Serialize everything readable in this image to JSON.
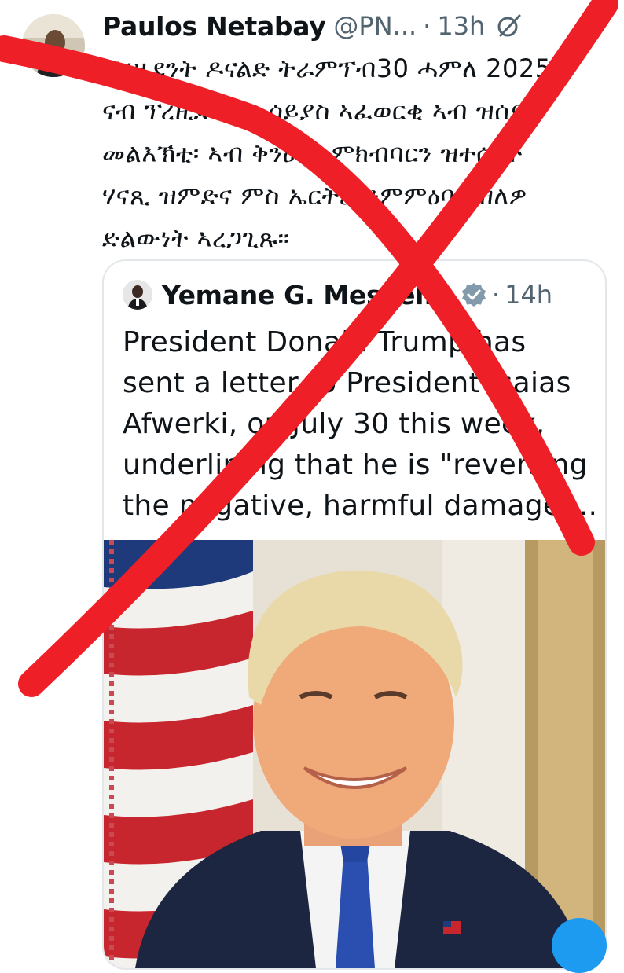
{
  "tweet": {
    "author_name": "Paulos Netabay",
    "author_handle": "@PN...",
    "separator": "·",
    "time": "13h",
    "grok_icon": "grok-icon",
    "text_lines": [
      "ፕረዚደንት ዶናልድ ትራምፕብ30 ሓምለ 2025",
      "ናብ ፕረዚደንት ኢሳይያስ ኣፈወርቂ ኣብ ዝሰደዶ",
      "መልእኽቲ፡ ኣብ ቅንዕናን ምክብባርን ዝተሰረተ",
      "ሃናጺ ዝምድና ምስ ኤርትራ ንምምዕባል ዘለዎ",
      "ድልውነት ኣረጋጊጹ።"
    ]
  },
  "quoted": {
    "author_name": "Yemane G. Meskel...",
    "verified_icon": "verified-badge-icon",
    "separator": "·",
    "time": "14h",
    "text_lines": [
      "President Donald Trump has",
      "sent a letter to President Isaias",
      "Afwerki, on July 30 this week,",
      "underlining that he is \"reversing",
      "the negative, harmful damage ..."
    ],
    "photo_icon": "portrait-photo"
  },
  "overlay": {
    "icon": "red-x-cross-out",
    "color": "#ef1f27"
  },
  "colors": {
    "text": "#0f1419",
    "secondary": "#536471",
    "accent": "#1d9bf0",
    "border": "#e3e7ea"
  }
}
